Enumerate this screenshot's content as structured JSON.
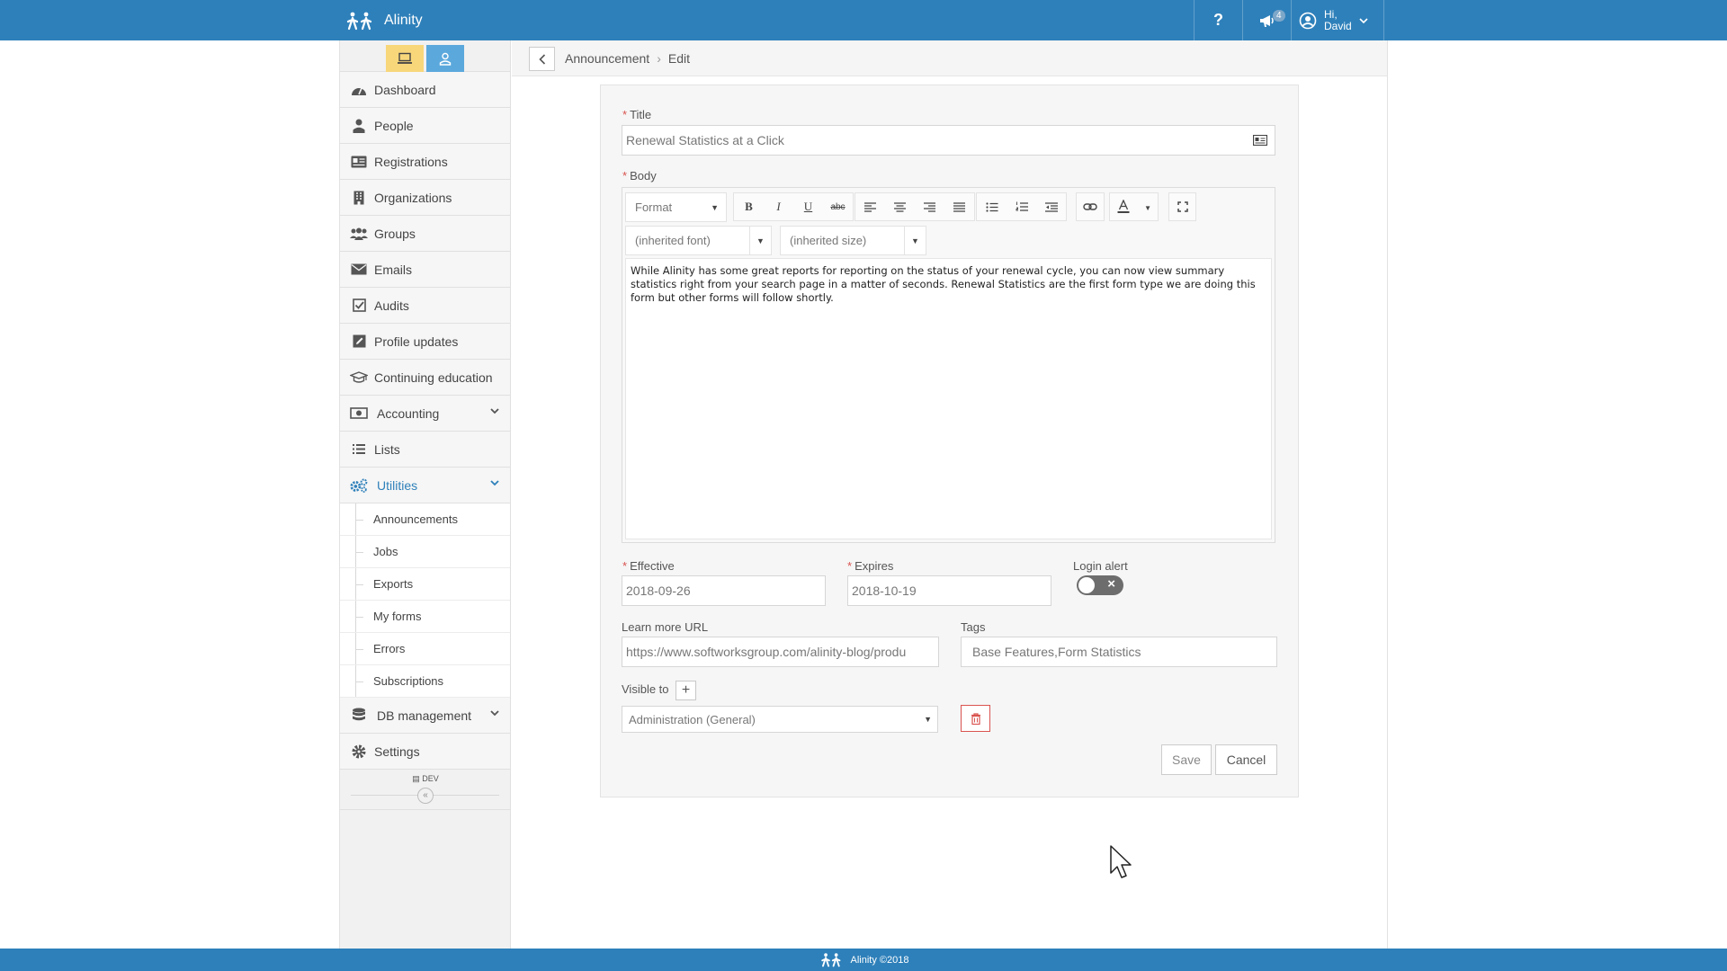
{
  "header": {
    "brand": "Alinity",
    "help_label": "?",
    "announcements_count": "4",
    "greeting_line1": "Hi,",
    "greeting_line2": "David",
    "bar_color": "#2e80ba"
  },
  "sidebar": {
    "items": [
      {
        "label": "Dashboard",
        "icon": "dashboard-icon"
      },
      {
        "label": "People",
        "icon": "person-icon"
      },
      {
        "label": "Registrations",
        "icon": "id-card-icon"
      },
      {
        "label": "Organizations",
        "icon": "building-icon"
      },
      {
        "label": "Groups",
        "icon": "users-icon"
      },
      {
        "label": "Emails",
        "icon": "envelope-icon"
      },
      {
        "label": "Audits",
        "icon": "checkbox-icon"
      },
      {
        "label": "Profile updates",
        "icon": "edit-icon"
      },
      {
        "label": "Continuing education",
        "icon": "graduation-cap-icon"
      },
      {
        "label": "Accounting",
        "icon": "money-icon"
      },
      {
        "label": "Lists",
        "icon": "list-icon"
      },
      {
        "label": "Utilities",
        "icon": "cogs-icon"
      },
      {
        "label": "DB management",
        "icon": "database-icon"
      },
      {
        "label": "Settings",
        "icon": "gear-icon"
      }
    ],
    "utilities_sub": [
      "Announcements",
      "Jobs",
      "Exports",
      "My forms",
      "Errors",
      "Subscriptions"
    ],
    "dev_label": "DEV",
    "collapse_label": "«"
  },
  "breadcrumb": {
    "items": [
      "Announcement",
      "Edit"
    ],
    "separator": "›"
  },
  "form": {
    "title_label": "Title",
    "title_value": "Renewal Statistics at a Click",
    "body_label": "Body",
    "format_label": "Format",
    "font_label": "(inherited font)",
    "size_label": "(inherited size)",
    "body_text": "While Alinity has some great reports for reporting on the status of your renewal cycle, you can now view summary statistics right from your search page in a matter of seconds. Renewal Statistics are the first form type we are doing this form but other forms will follow shortly.",
    "effective_label": "Effective",
    "effective_value": "2018-09-26",
    "expires_label": "Expires",
    "expires_value": "2018-10-19",
    "login_alert_label": "Login alert",
    "login_alert_on": false,
    "url_label": "Learn more URL",
    "url_value": "https://www.softworksgroup.com/alinity-blog/produ",
    "tags_label": "Tags",
    "tags_value": "Base Features,Form Statistics",
    "visible_label": "Visible to",
    "visible_value": "Administration (General)",
    "save_label": "Save",
    "cancel_label": "Cancel",
    "required_mark": "*"
  },
  "footer": {
    "text": "Alinity ©2018"
  }
}
